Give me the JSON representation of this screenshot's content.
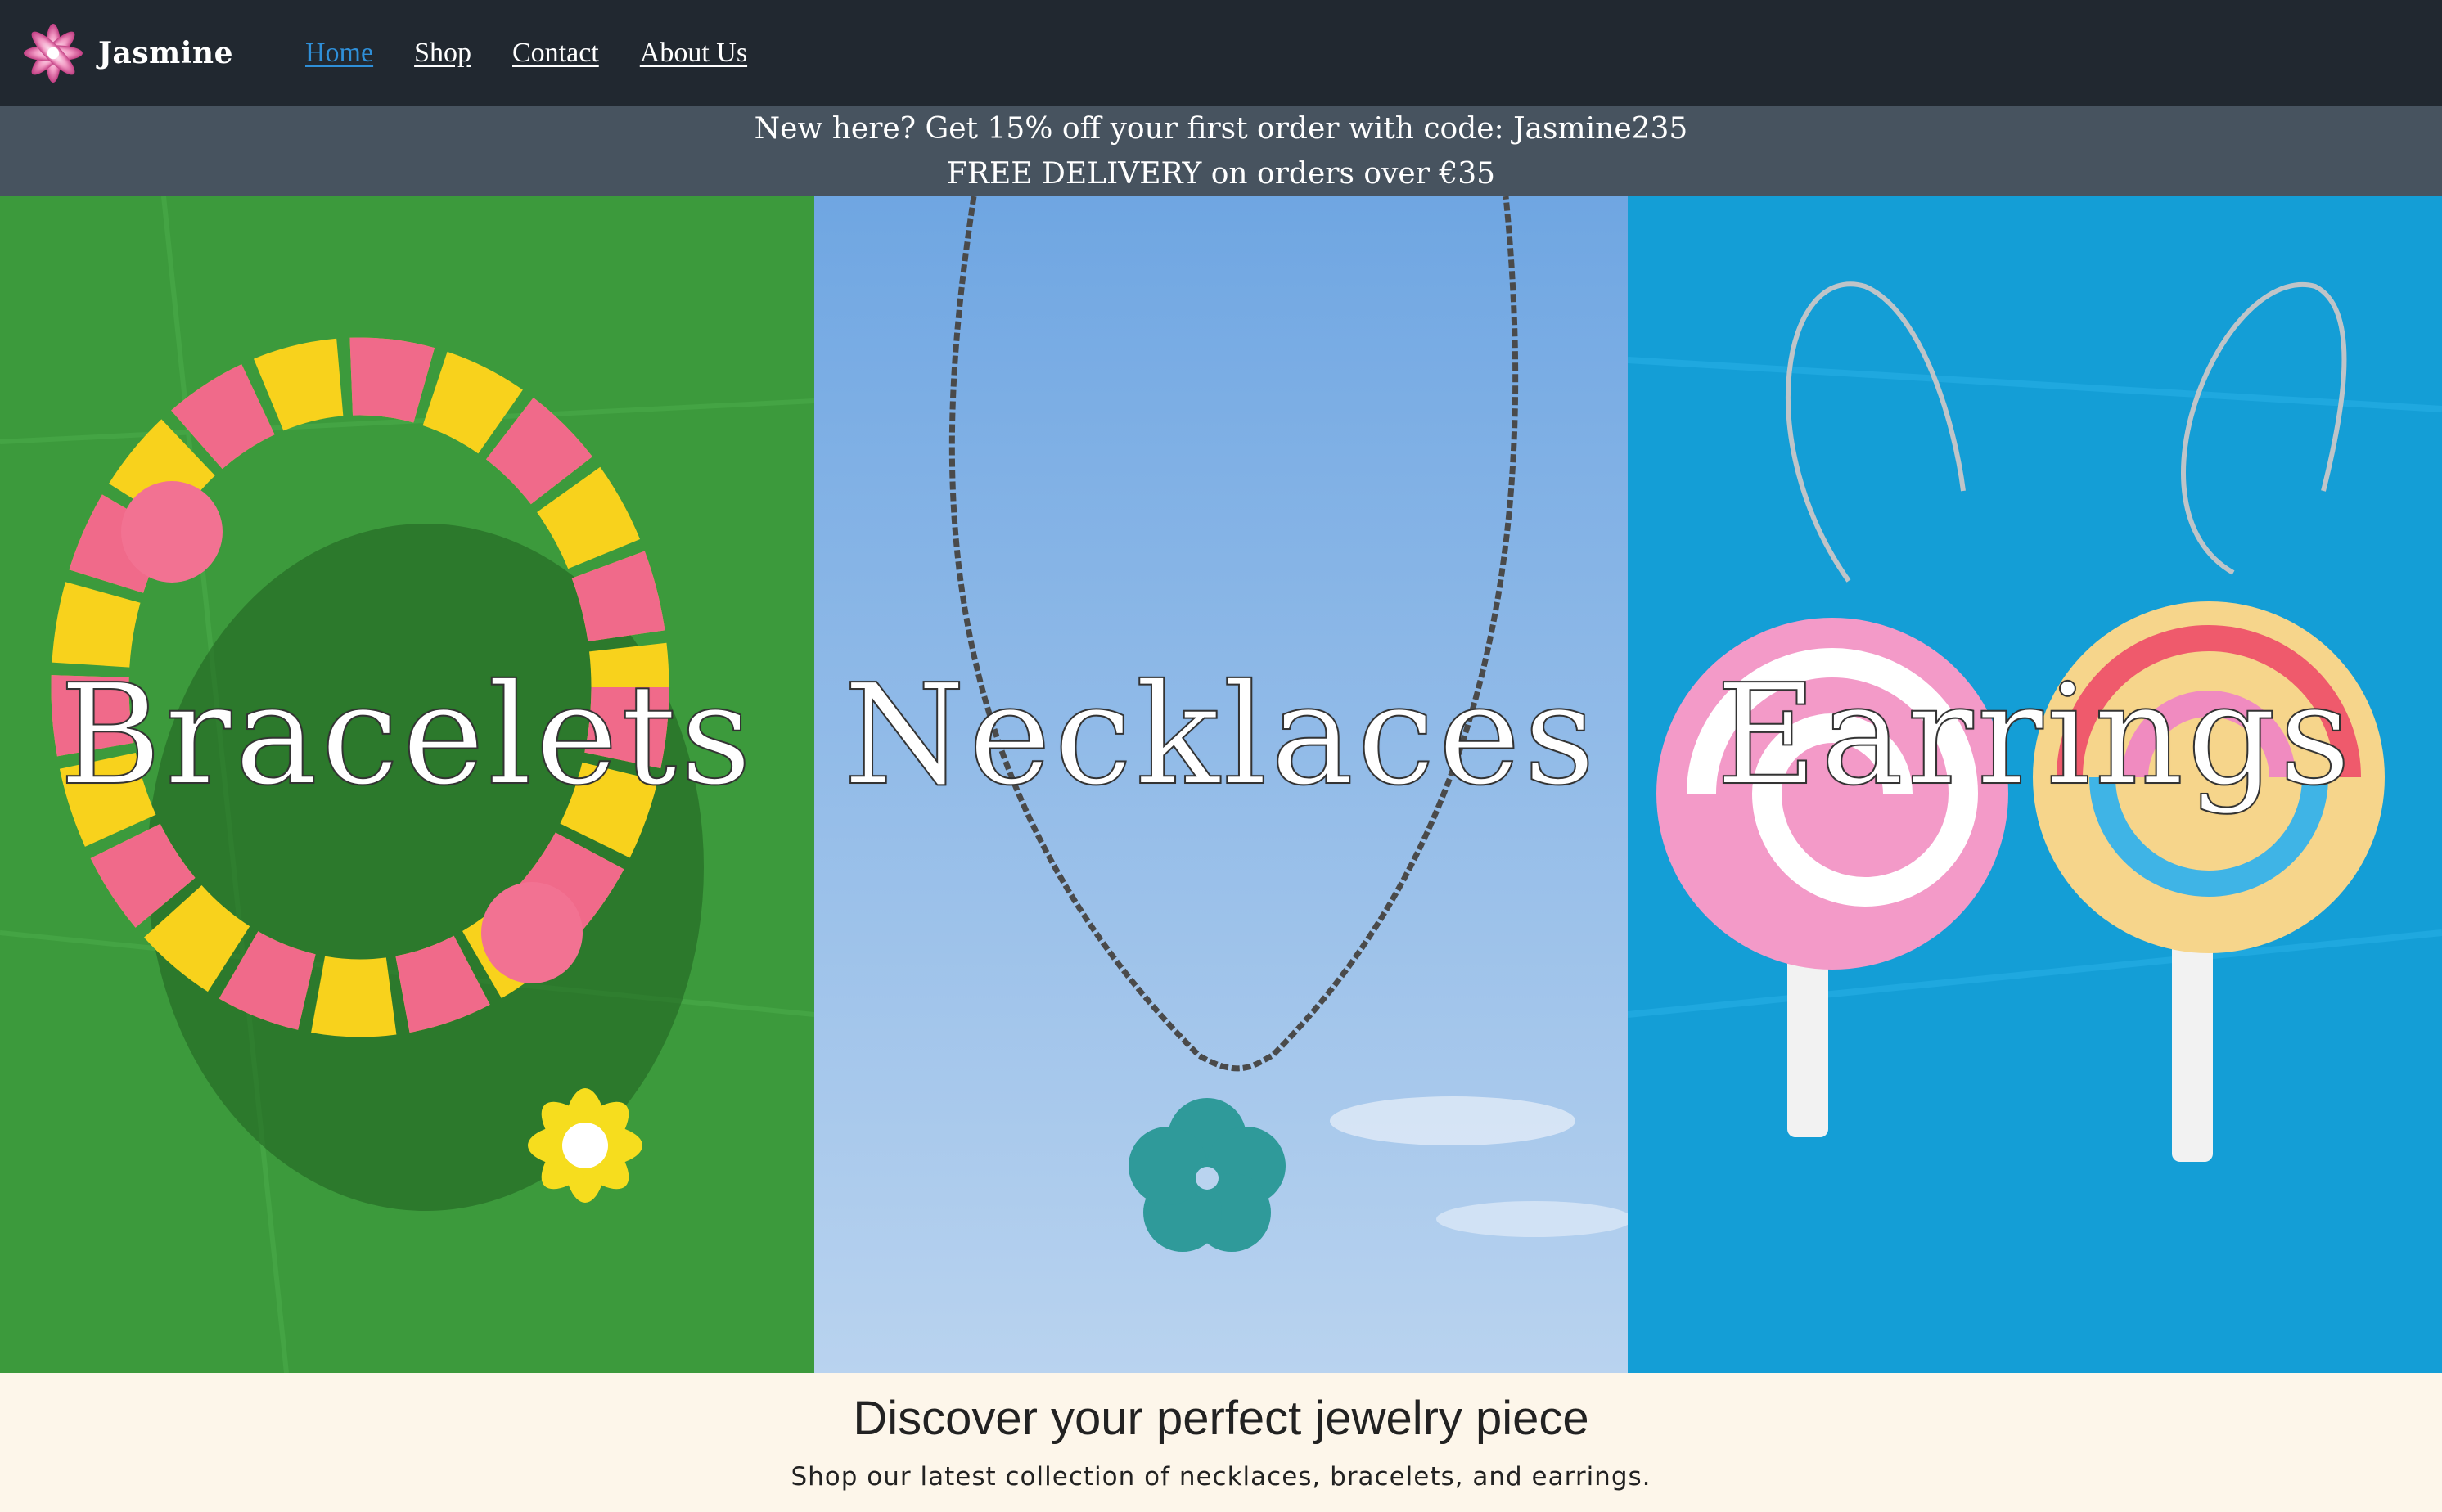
{
  "brand": {
    "name": "Jasmine",
    "logo_icon": "flower-logo-icon"
  },
  "nav": {
    "items": [
      {
        "label": "Home",
        "active": true
      },
      {
        "label": "Shop",
        "active": false
      },
      {
        "label": "Contact",
        "active": false
      },
      {
        "label": "About Us",
        "active": false
      }
    ]
  },
  "promo": {
    "line1": "New here? Get 15% off your first order with code: Jasmine235",
    "line2": "FREE DELIVERY on orders over €35"
  },
  "categories": [
    {
      "title": "Bracelets"
    },
    {
      "title": "Necklaces"
    },
    {
      "title": "Earrings"
    }
  ],
  "intro": {
    "heading": "Discover your perfect jewelry piece",
    "subtext": "Shop our latest collection of necklaces, bracelets, and earrings."
  },
  "colors": {
    "navbar": "#212830",
    "promo": "#47535f",
    "active_link": "#2f8fd8",
    "page_bg": "#fdf6ea"
  }
}
